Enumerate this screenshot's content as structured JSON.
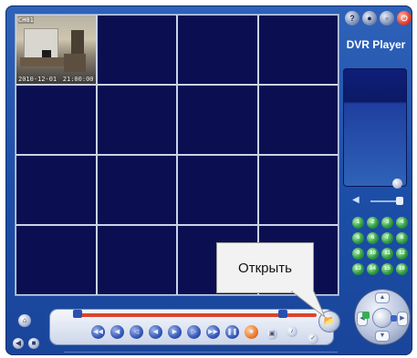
{
  "app": {
    "brand": "DVR Player"
  },
  "grid": {
    "camera1": {
      "channel_label": "CH01",
      "date": "2010-12-01",
      "time": "21:00:00"
    }
  },
  "tooltip": {
    "text": "Открыть"
  },
  "channels": [
    "1",
    "2",
    "3",
    "4",
    "5",
    "6",
    "7",
    "8",
    "9",
    "10",
    "11",
    "12",
    "13",
    "14",
    "15",
    "16"
  ],
  "colors": {
    "window_blue": "#1c4ea7",
    "video_bg": "#0b0f52",
    "channel_green": "#2f9e44",
    "seek_red": "#d9442f"
  }
}
